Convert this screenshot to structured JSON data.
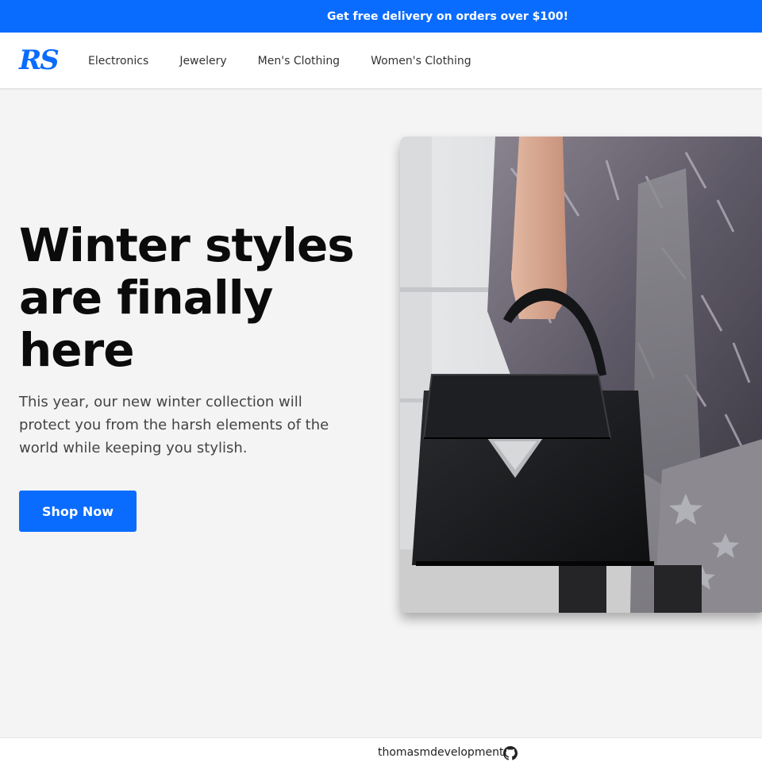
{
  "promo": {
    "text": "Get free delivery on orders over $100!"
  },
  "header": {
    "logo_text": "RS",
    "nav": [
      {
        "label": "Electronics"
      },
      {
        "label": "Jewelery"
      },
      {
        "label": "Men's Clothing"
      },
      {
        "label": "Women's Clothing"
      }
    ]
  },
  "hero": {
    "title": "Winter styles are finally here",
    "description": "This year, our new winter collection will protect you from the harsh elements of the world while keeping you stylish.",
    "cta_label": "Shop Now",
    "image_icon": "woman-handbag-photo"
  },
  "footer": {
    "author": "thomasmdevelopment",
    "icon": "github-icon"
  },
  "colors": {
    "accent": "#0a6cff",
    "page_bg": "#f4f4f4",
    "text_dark": "#0b0b0b"
  }
}
